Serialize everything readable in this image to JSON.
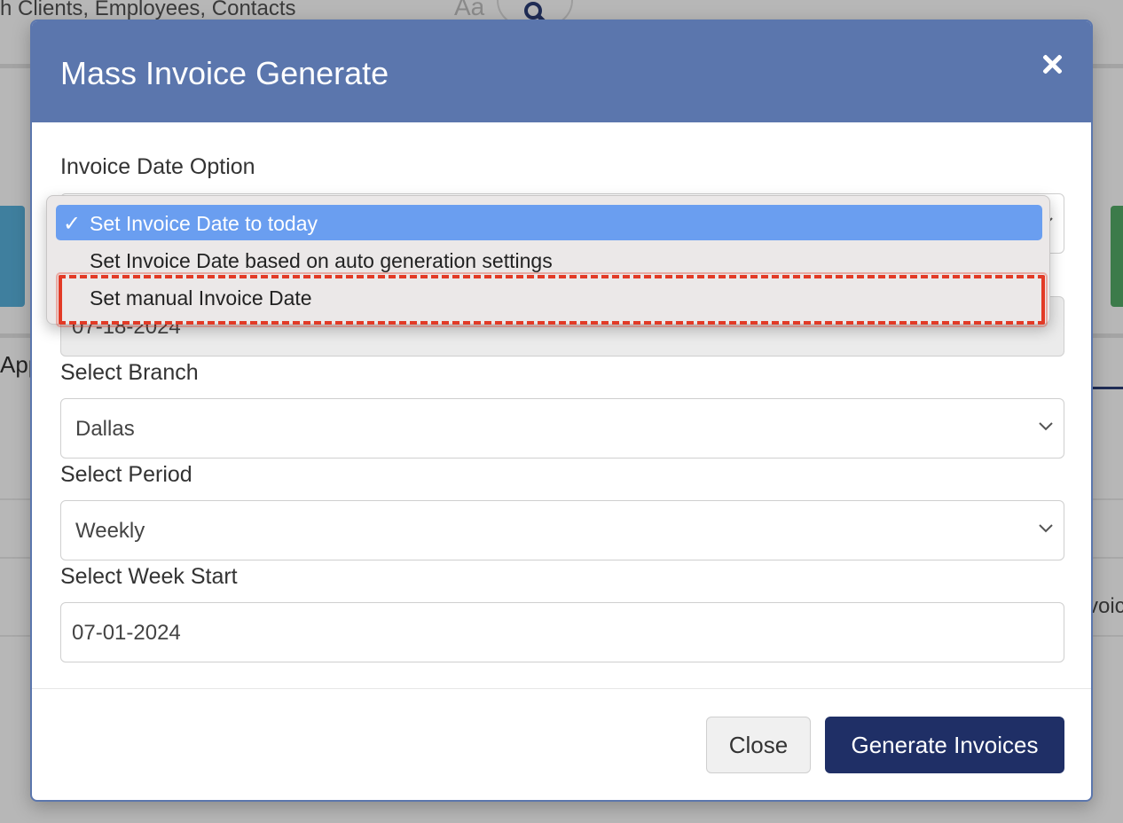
{
  "background": {
    "search_placeholder": "h Clients, Employees, Contacts",
    "font_toggle": "Aa",
    "tab_partial": "App",
    "col_partial": "voic"
  },
  "modal": {
    "title": "Mass Invoice Generate",
    "close_icon": "close-icon",
    "fields": {
      "invoice_date_option": {
        "label": "Invoice Date Option",
        "options": [
          "Set Invoice Date to today",
          "Set Invoice Date based on auto generation settings",
          "Set manual Invoice Date"
        ],
        "selected": "Set Invoice Date to today",
        "check_mark": "✓"
      },
      "invoice_date": {
        "value": "07-18-2024"
      },
      "branch": {
        "label": "Select Branch",
        "value": "Dallas"
      },
      "period": {
        "label": "Select Period",
        "value": "Weekly"
      },
      "week_start": {
        "label": "Select Week Start",
        "value": "07-01-2024"
      }
    },
    "footer": {
      "close_label": "Close",
      "generate_label": "Generate Invoices"
    }
  },
  "colors": {
    "header": "#5b76ad",
    "primary_button": "#1f2f66",
    "dropdown_selected": "#6a9ef0",
    "annotation": "#e23a26"
  }
}
